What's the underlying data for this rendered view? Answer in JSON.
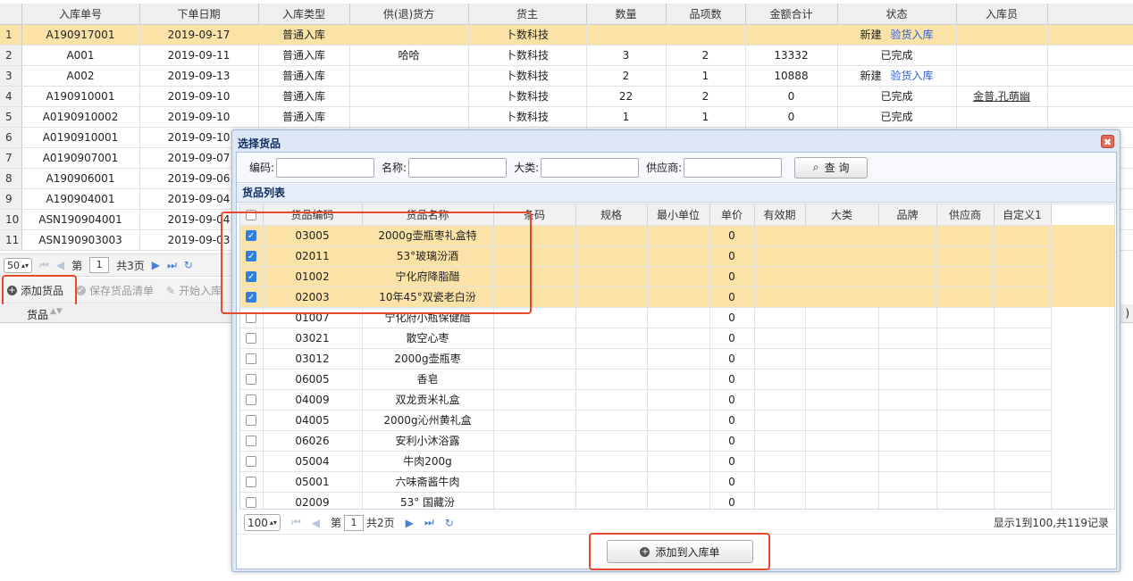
{
  "main_grid": {
    "columns": [
      "入库单号",
      "下单日期",
      "入库类型",
      "供(退)货方",
      "货主",
      "数量",
      "品项数",
      "金额合计",
      "状态",
      "入库员"
    ],
    "rows": [
      {
        "num": "1",
        "cells": [
          "A190917001",
          "2019-09-17",
          "普通入库",
          "",
          "卜数科技",
          "",
          "",
          "",
          "新建",
          ""
        ],
        "link": "验货入库",
        "selected": true
      },
      {
        "num": "2",
        "cells": [
          "A001",
          "2019-09-11",
          "普通入库",
          "哈哈",
          "卜数科技",
          "3",
          "2",
          "13332",
          "已完成",
          ""
        ]
      },
      {
        "num": "3",
        "cells": [
          "A002",
          "2019-09-13",
          "普通入库",
          "",
          "卜数科技",
          "2",
          "1",
          "10888",
          "新建",
          ""
        ],
        "link": "验货入库"
      },
      {
        "num": "4",
        "cells": [
          "A190910001",
          "2019-09-10",
          "普通入库",
          "",
          "卜数科技",
          "22",
          "2",
          "0",
          "已完成",
          "金普,孔萌幽"
        ]
      },
      {
        "num": "5",
        "cells": [
          "A0190910002",
          "2019-09-10",
          "普通入库",
          "",
          "卜数科技",
          "1",
          "1",
          "0",
          "已完成",
          ""
        ]
      },
      {
        "num": "6",
        "cells": [
          "A0190910001",
          "2019-09-10"
        ]
      },
      {
        "num": "7",
        "cells": [
          "A0190907001",
          "2019-09-07"
        ]
      },
      {
        "num": "8",
        "cells": [
          "A190906001",
          "2019-09-06"
        ]
      },
      {
        "num": "9",
        "cells": [
          "A190904001",
          "2019-09-04"
        ]
      },
      {
        "num": "10",
        "cells": [
          "ASN190904001",
          "2019-09-04"
        ]
      },
      {
        "num": "11",
        "cells": [
          "ASN190903003",
          "2019-09-03"
        ]
      }
    ]
  },
  "main_pager": {
    "page_size": "50",
    "page_prefix": "第",
    "page": "1",
    "page_total": "共3页"
  },
  "main_toolbar": {
    "add": "添加货品",
    "save": "保存货品清单",
    "start": "开始入库"
  },
  "bottom_grid": {
    "col1": "货品"
  },
  "dialog": {
    "title": "选择货品",
    "close": "✖",
    "search": {
      "code_label": "编码:",
      "name_label": "名称:",
      "category_label": "大类:",
      "supplier_label": "供应商:",
      "query_button": "查 询"
    },
    "list_title": "货品列表",
    "columns": [
      "货品编码",
      "货品名称",
      "条码",
      "规格",
      "最小单位",
      "单价",
      "有效期",
      "大类",
      "品牌",
      "供应商",
      "自定义1"
    ],
    "rows": [
      {
        "code": "03005",
        "name": "2000g壶瓶枣礼盒特",
        "price": "0",
        "checked": true
      },
      {
        "code": "02011",
        "name": "53°玻璃汾酒",
        "price": "0",
        "checked": true
      },
      {
        "code": "01002",
        "name": "宁化府降脂醋",
        "price": "0",
        "checked": true
      },
      {
        "code": "02003",
        "name": "10年45°双瓷老白汾",
        "price": "0",
        "checked": true
      },
      {
        "code": "01007",
        "name": "宁化府小瓶保健醋",
        "price": "0",
        "checked": false
      },
      {
        "code": "03021",
        "name": "散空心枣",
        "price": "0",
        "checked": false
      },
      {
        "code": "03012",
        "name": "2000g壶瓶枣",
        "price": "0",
        "checked": false
      },
      {
        "code": "06005",
        "name": "香皂",
        "price": "0",
        "checked": false
      },
      {
        "code": "04009",
        "name": "双龙贡米礼盒",
        "price": "0",
        "checked": false
      },
      {
        "code": "04005",
        "name": "2000g沁州黄礼盒",
        "price": "0",
        "checked": false
      },
      {
        "code": "06026",
        "name": "安利小沐浴露",
        "price": "0",
        "checked": false
      },
      {
        "code": "05004",
        "name": "牛肉200g",
        "price": "0",
        "checked": false
      },
      {
        "code": "05001",
        "name": "六味斋酱牛肉",
        "price": "0",
        "checked": false
      },
      {
        "code": "02009",
        "name": "53° 国藏汾",
        "price": "0",
        "checked": false
      }
    ],
    "pager": {
      "page_size": "100",
      "page_prefix": "第",
      "page": "1",
      "page_total": "共2页",
      "info": "显示1到100,共119记录"
    },
    "add_button": "添加到入库单"
  },
  "colors": {
    "highlight": "#e8492a",
    "selected_row": "#fbe3a7",
    "link": "#2a5fd8"
  }
}
